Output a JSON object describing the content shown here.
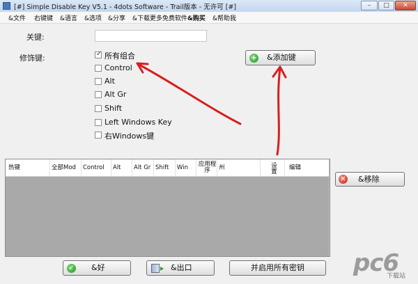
{
  "window": {
    "title": "[#] Simple Disable Key V5.1 - 4dots Software - Trail版本 - 无许可 [#]",
    "controls": {
      "minimize": "–",
      "maximize": "□",
      "close": "✕"
    }
  },
  "menu": [
    "&文件",
    "右键键",
    "&语言",
    "&选项",
    "&分享",
    "&下载更多免费软件",
    "&购买",
    "&帮助我"
  ],
  "form": {
    "key_label": "关键:",
    "key_value": "",
    "modifier_label": "修饰键:",
    "modifiers": [
      {
        "label": "所有组合",
        "checked": true
      },
      {
        "label": "Control",
        "checked": false
      },
      {
        "label": "Alt",
        "checked": false
      },
      {
        "label": "Alt Gr",
        "checked": false
      },
      {
        "label": "Shift",
        "checked": false
      },
      {
        "label": "Left Windows Key",
        "checked": false
      },
      {
        "label": "右Windows键",
        "checked": false
      }
    ]
  },
  "buttons": {
    "add": "&添加键",
    "remove": "&移除",
    "ok": "&好",
    "exit": "&出口",
    "enable_all": "并启用所有密钥"
  },
  "table": {
    "columns": [
      "热键",
      "全部Mod",
      "Control",
      "Alt",
      "Alt Gr",
      "Shift",
      "Win",
      "应用程序",
      "州",
      "设置",
      "编辑"
    ]
  },
  "watermark": {
    "logo": "pc6",
    "sub": "下载站"
  },
  "colors": {
    "arrow": "#d81e1e",
    "table_bg": "#a9a9a9",
    "check": "#2a3f7a"
  }
}
